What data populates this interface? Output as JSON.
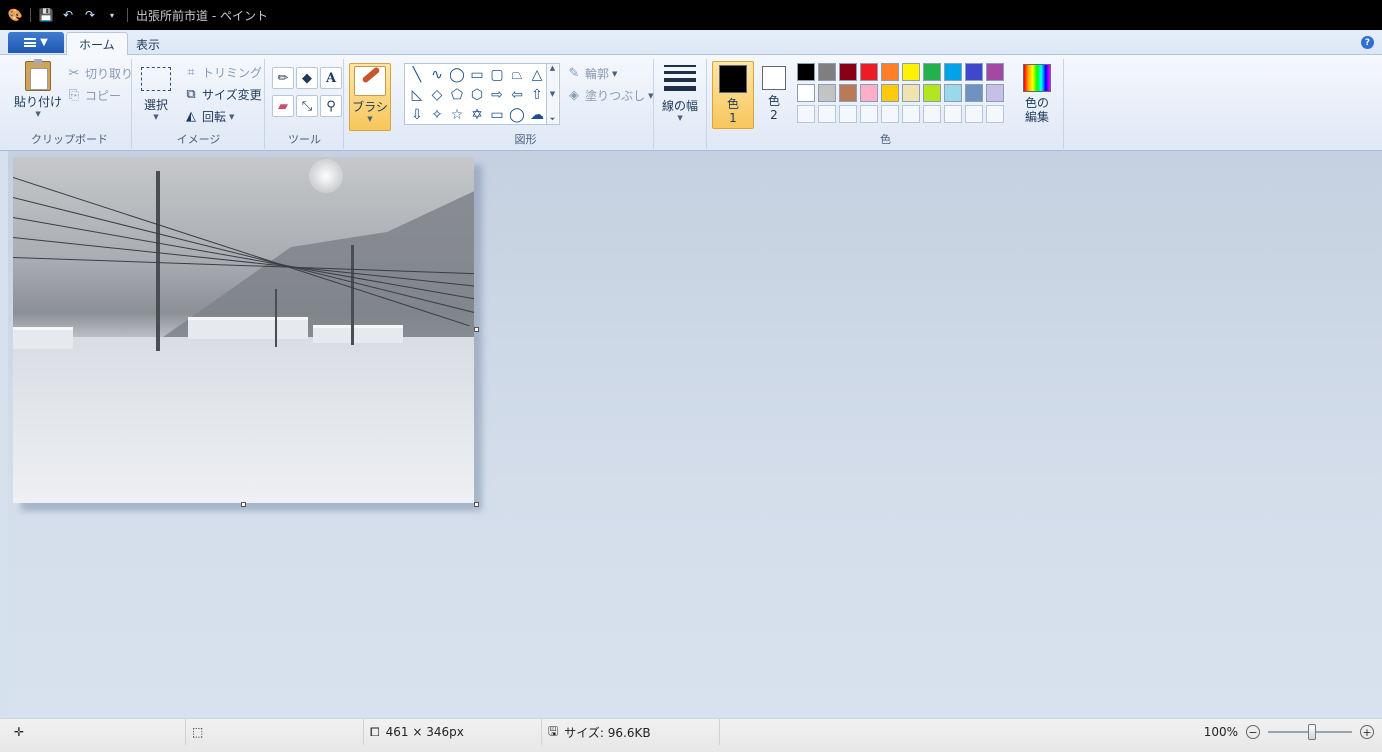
{
  "window": {
    "title": "出張所前市道 - ペイント"
  },
  "tabs": [
    {
      "label": "ホーム"
    },
    {
      "label": "表示"
    }
  ],
  "ribbon": {
    "clipboard": {
      "paste": "貼り付け",
      "cut": "切り取り",
      "copy": "コピー",
      "group": "クリップボード"
    },
    "image": {
      "select": "選択",
      "crop": "トリミング",
      "resize": "サイズ変更",
      "rotate": "回転",
      "group": "イメージ"
    },
    "tools": {
      "group": "ツール",
      "items": [
        "pencil-icon",
        "fill-icon",
        "text-icon",
        "eraser-icon",
        "color-picker-icon",
        "magnifier-icon"
      ]
    },
    "brush": {
      "label": "ブラシ"
    },
    "shapes": {
      "outline": "輪郭",
      "fill": "塗りつぶし",
      "group": "図形",
      "items": [
        "╲",
        "∿",
        "◯",
        "▭",
        "▢",
        "⏢",
        "△",
        "◺",
        "◇",
        "⬠",
        "⬡",
        "⇨",
        "⇦",
        "⇧",
        "⇩",
        "✧",
        "☆",
        "✡",
        "▭",
        "◯",
        "☁"
      ]
    },
    "size": {
      "label": "線の幅"
    },
    "colors": {
      "color1_line1": "色",
      "color1_line2": "1",
      "color2_line1": "色",
      "color2_line2": "2",
      "edit_line1": "色の",
      "edit_line2": "編集",
      "group": "色",
      "color1_value": "#000000",
      "color2_value": "#ffffff",
      "palette": [
        "#000000",
        "#7f7f7f",
        "#880015",
        "#ed1c24",
        "#ff7f27",
        "#fff200",
        "#22b14c",
        "#00a2e8",
        "#3f48cc",
        "#a349a4",
        "#ffffff",
        "#c3c3c3",
        "#b97a57",
        "#ffaec9",
        "#ffc90e",
        "#efe4b0",
        "#b5e61d",
        "#99d9ea",
        "#7092be",
        "#c8bfe7",
        "",
        "",
        "",
        "",
        "",
        "",
        "",
        "",
        "",
        ""
      ]
    }
  },
  "status": {
    "dimensions": "461 × 346px",
    "filesize": "サイズ: 96.6KB",
    "zoom": "100%"
  }
}
